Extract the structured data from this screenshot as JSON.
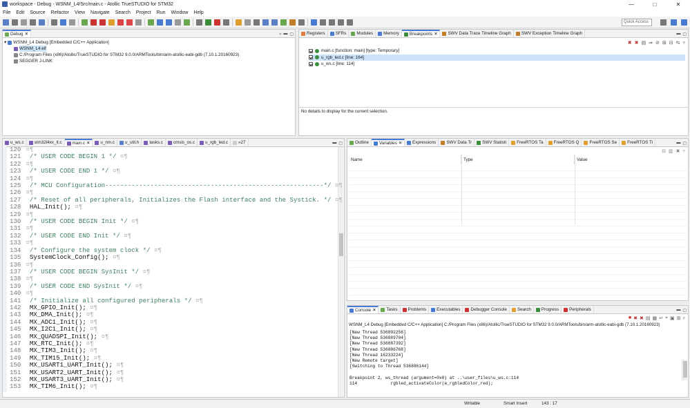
{
  "window": {
    "title": "workspace - Debug - WSNM_L4/Src/main.c - Atollic TrueSTUDIO for STM32",
    "min": "—",
    "max": "□",
    "close": "✕"
  },
  "menu": [
    "File",
    "Edit",
    "Source",
    "Refactor",
    "View",
    "Navigate",
    "Search",
    "Project",
    "Run",
    "Window",
    "Help"
  ],
  "toolbar": {
    "quick_access": "Quick Access"
  },
  "debug_view": {
    "tab": "Debug",
    "tree": [
      "WSNM_L4 Debug [Embedded C/C++ Application]",
      "WSNM_L4.elf",
      "C:/Program Files (x86)/Atollic/TrueSTUDIO for STM32 9.0.0/ARMTools/bin/arm-atollic-eabi-gdb (7.10.1.20160923)",
      "SEGGER J-LINK"
    ]
  },
  "right_top": {
    "tabs": [
      "Registers",
      "SFRs",
      "Modules",
      "Memory",
      "Breakpoints",
      "SWV Data Trace Timeline Graph",
      "SWV Exception Timeline Graph"
    ],
    "breakpoints": [
      "main.c [function: main] [type: Temporary]",
      "u_rgb_led.c [line: 164]",
      "u_ws.c [line: 114]"
    ],
    "details": "No details to display for the current selection."
  },
  "editor": {
    "tabs": [
      "u_ws.c",
      "stm32l4xx_it.c",
      "main.c",
      "u_nm.c",
      "u_util.h",
      "tasks.c",
      "cmsis_os.c",
      "u_rgb_led.c",
      "»27"
    ],
    "lines": [
      {
        "n": "120",
        "t": "",
        "c": false
      },
      {
        "n": "121",
        "t": "  /* USER CODE BEGIN 1 */",
        "c": true
      },
      {
        "n": "122",
        "t": "",
        "c": false
      },
      {
        "n": "123",
        "t": "  /* USER CODE END 1 */",
        "c": true
      },
      {
        "n": "124",
        "t": "",
        "c": false
      },
      {
        "n": "125",
        "t": "  /* MCU Configuration----------------------------------------------------------*/",
        "c": true
      },
      {
        "n": "126",
        "t": "",
        "c": false
      },
      {
        "n": "127",
        "t": "  /* Reset of all peripherals, Initializes the Flash interface and the Systick. */",
        "c": true
      },
      {
        "n": "128",
        "t": "  HAL_Init();",
        "c": false
      },
      {
        "n": "129",
        "t": "",
        "c": false
      },
      {
        "n": "130",
        "t": "  /* USER CODE BEGIN Init */",
        "c": true
      },
      {
        "n": "131",
        "t": "",
        "c": false
      },
      {
        "n": "132",
        "t": "  /* USER CODE END Init */",
        "c": true
      },
      {
        "n": "133",
        "t": "",
        "c": false
      },
      {
        "n": "134",
        "t": "  /* Configure the system clock */",
        "c": true
      },
      {
        "n": "135",
        "t": "  SystemClock_Config();",
        "c": false
      },
      {
        "n": "136",
        "t": "",
        "c": false
      },
      {
        "n": "137",
        "t": "  /* USER CODE BEGIN SysInit */",
        "c": true
      },
      {
        "n": "138",
        "t": "",
        "c": false
      },
      {
        "n": "139",
        "t": "  /* USER CODE END SysInit */",
        "c": true
      },
      {
        "n": "140",
        "t": "",
        "c": false
      },
      {
        "n": "141",
        "t": "  /* Initialize all configured peripherals */",
        "c": true
      },
      {
        "n": "142",
        "t": "  MX_GPIO_Init();",
        "c": false
      },
      {
        "n": "143",
        "t": "  MX_DMA_Init();",
        "c": false
      },
      {
        "n": "144",
        "t": "  MX_ADC1_Init();",
        "c": false
      },
      {
        "n": "145",
        "t": "  MX_I2C1_Init();",
        "c": false
      },
      {
        "n": "146",
        "t": "  MX_QUADSPI_Init();",
        "c": false
      },
      {
        "n": "147",
        "t": "  MX_RTC_Init();",
        "c": false
      },
      {
        "n": "148",
        "t": "  MX_TIM3_Init();",
        "c": false
      },
      {
        "n": "149",
        "t": "  MX_TIM15_Init();",
        "c": false
      },
      {
        "n": "150",
        "t": "  MX_USART1_UART_Init();",
        "c": false
      },
      {
        "n": "151",
        "t": "  MX_USART2_UART_Init();",
        "c": false
      },
      {
        "n": "152",
        "t": "  MX_USART3_UART_Init();",
        "c": false
      },
      {
        "n": "153",
        "t": "  MX_TIM6_Init();",
        "c": false
      }
    ]
  },
  "variables_view": {
    "tabs": [
      "Outline",
      "Variables",
      "Expressions",
      "SWV Data Tr",
      "SWV Statisti",
      "FreeRTOS Ta",
      "FreeRTOS Q",
      "FreeRTOS Se",
      "FreeRTOS Ti"
    ],
    "columns": [
      "Name",
      "Type",
      "Value"
    ]
  },
  "console_view": {
    "tabs": [
      "Console",
      "Tasks",
      "Problems",
      "Executables",
      "Debugger Console",
      "Search",
      "Progress",
      "Peripherals"
    ],
    "header": "WSNM_L4 Debug [Embedded C/C++ Application] C:/Program Files (x86)/Atollic/TrueSTUDIO for STM32 9.0.0/ARMTools/bin/arm-atollic-eabi-gdb (7.10.1.20160923)",
    "lines": [
      "[New Thread 536892256]",
      "[New Thread 536889704]",
      "[New Thread 536887392]",
      "[New Thread 536886768]",
      "[New Thread 16233224]",
      "[New Remote target]",
      "[Switching to Thread 536886144]",
      "",
      "Breakpoint 2, ws_thread (argument=0x0) at ..\\user_files\\u_ws.c:114",
      "114             rgbled_activateColor(e_rgbledColor_red);"
    ]
  },
  "status": {
    "mode": "Writable",
    "insert": "Smart Insert",
    "position": "143 : 17"
  },
  "colors": {
    "accent": "#4a7bd3",
    "comment": "#3f7f5f",
    "selection": "#cde3f8"
  }
}
